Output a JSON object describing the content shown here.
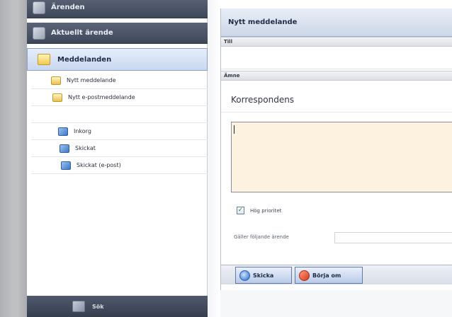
{
  "nav": {
    "cases": "Ärenden",
    "current_case": "Aktuellt ärende",
    "messages": "Meddelanden",
    "sub_items": [
      {
        "label": "Nytt meddelande",
        "icon": "envelope-icon"
      },
      {
        "label": "Nytt e-postmeddelande",
        "icon": "envelope-icon"
      },
      {
        "label": "Inkorg",
        "icon": "inbox-icon"
      },
      {
        "label": "Skickat",
        "icon": "sent-icon"
      },
      {
        "label": "Skickat (e-post)",
        "icon": "sent-email-icon"
      }
    ],
    "footer": "Sök"
  },
  "compose": {
    "title": "Nytt meddelande",
    "to_label": "Till",
    "subject_label": "Ämne",
    "subject_value": "Korrespondens",
    "high_priority_label": "Hög prioritet",
    "high_priority_checked": true,
    "related_case_label": "Gäller följande ärende",
    "send_button": "Skicka",
    "reset_button": "Börja om"
  }
}
